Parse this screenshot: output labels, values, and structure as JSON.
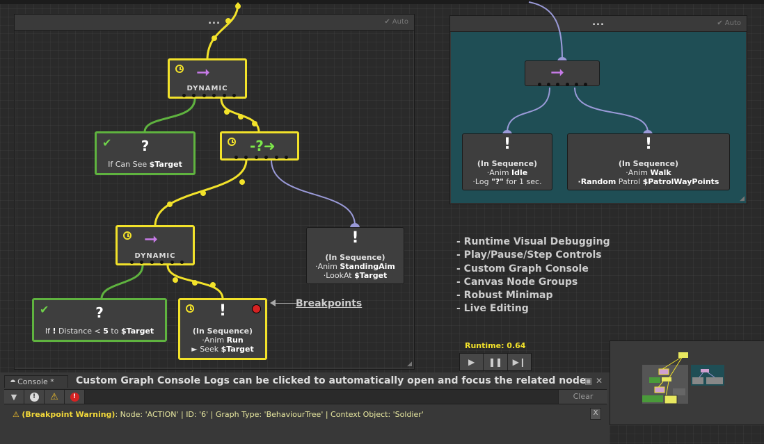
{
  "groups": [
    {
      "title": "...",
      "auto_label": "Auto"
    },
    {
      "title": "...",
      "auto_label": "Auto"
    }
  ],
  "nodes": {
    "root_dynamic": {
      "label": "DYNAMIC"
    },
    "if_can_see": {
      "text_prefix": "If Can See ",
      "text_var": "$Target"
    },
    "dynamic2": {
      "label": "DYNAMIC"
    },
    "standing": {
      "line1": "(In Sequence)",
      "line2_prefix": "·Anim ",
      "line2_bold": "StandingAim",
      "line3_prefix": "·LookAt ",
      "line3_bold": "$Target"
    },
    "if_distance": {
      "part1": "If ",
      "part2": "!",
      "part3": " Distance < ",
      "part4": "5",
      "part5": " to ",
      "part6": "$Target"
    },
    "run": {
      "line1": "(In Sequence)",
      "line2_prefix": "·Anim ",
      "line2_bold": "Run",
      "line3_prefix": "► Seek ",
      "line3_bold": "$Target"
    },
    "idle": {
      "line1": "(In Sequence)",
      "line2_prefix": "·Anim ",
      "line2_bold": "Idle",
      "line3_prefix": "·Log ",
      "line3_bold": "\"?\"",
      "line3_suffix": " for 1 sec."
    },
    "walk": {
      "line1": "(In Sequence)",
      "line2_prefix": "·Anim ",
      "line2_bold": "Walk",
      "line3_bold1": "·Random",
      "line3_mid": " Patrol ",
      "line3_bold2": "$PatrolWayPoints"
    }
  },
  "features": [
    "- Runtime Visual Debugging",
    "- Play/Pause/Step Controls",
    "- Custom Graph Console",
    "- Canvas Node Groups",
    "- Robust Minimap",
    "- Live Editing"
  ],
  "breakpoints_label": "Breakpoints",
  "runtime": {
    "label": "Runtime: 0.64"
  },
  "console": {
    "tab_label": "Console *",
    "title": "Custom Graph Console Logs can be clicked to automatically open and focus the related node.",
    "clear_label": "Clear",
    "log": {
      "tag": "(Breakpoint Warning)",
      "message": ": Node: 'ACTION' | ID: '6' | Graph Type: 'BehaviourTree' | Context Object: 'Soldier'"
    }
  },
  "colors": {
    "active": "#f2e22a",
    "success": "#5fb33f",
    "teal_group": "#1f4e55",
    "idle_wire": "#9a9ad8",
    "breakpoint": "#d62222"
  }
}
